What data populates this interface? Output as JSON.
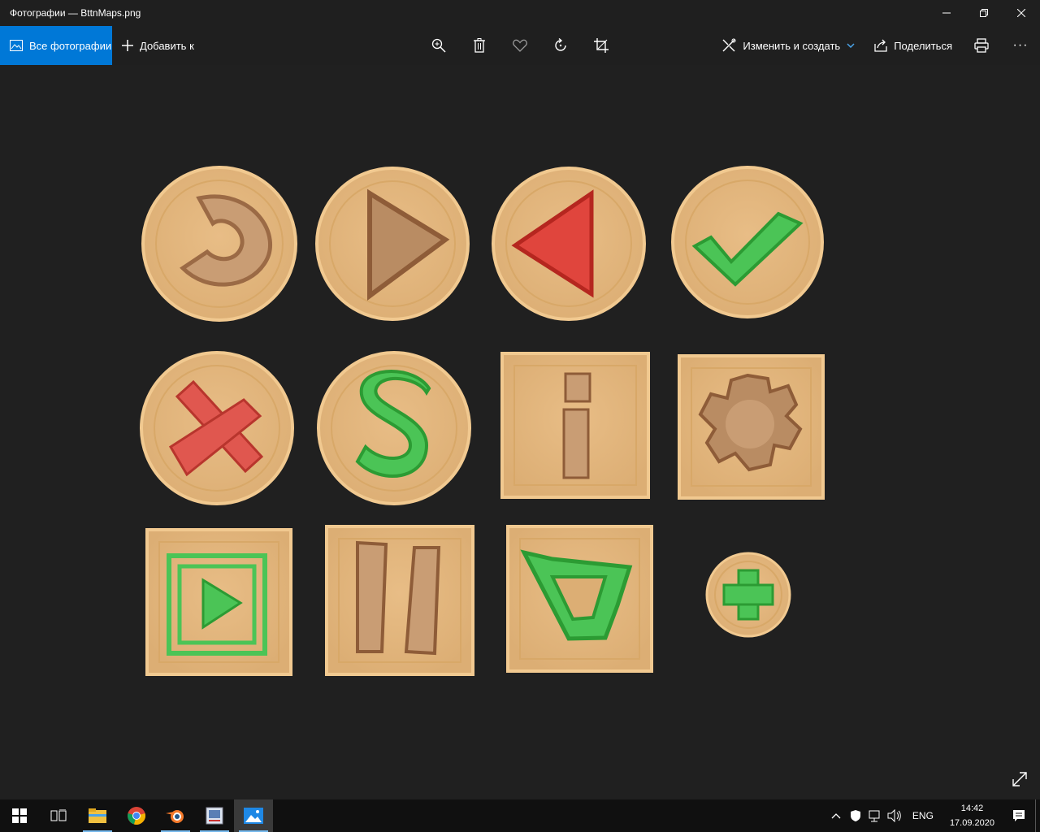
{
  "window": {
    "title": "Фотографии — BttnMaps.png"
  },
  "toolbar": {
    "all_photos_label": "Все фотографии",
    "add_to_label": "Добавить к",
    "edit_create_label": "Изменить и создать",
    "share_label": "Поделиться",
    "more_label": "···"
  },
  "image": {
    "filename": "BttnMaps.png",
    "buttons": [
      {
        "shape": "circle",
        "icon": "reload-arrow-icon",
        "color": "#9b6a45"
      },
      {
        "shape": "circle",
        "icon": "play-triangle-icon",
        "color": "#a97b53"
      },
      {
        "shape": "circle",
        "icon": "back-triangle-icon",
        "color": "#e0453d"
      },
      {
        "shape": "circle",
        "icon": "checkmark-icon",
        "color": "#3fc244"
      },
      {
        "shape": "circle",
        "icon": "cross-icon",
        "color": "#e0574f"
      },
      {
        "shape": "circle",
        "icon": "dollar-s-icon",
        "color": "#4bc456"
      },
      {
        "shape": "square",
        "icon": "info-i-icon",
        "color": "#9b6a45"
      },
      {
        "shape": "square",
        "icon": "gear-icon",
        "color": "#9b6a45"
      },
      {
        "shape": "square",
        "icon": "film-play-icon",
        "color": "#3fc244"
      },
      {
        "shape": "square",
        "icon": "pause-icon",
        "color": "#9b6a45"
      },
      {
        "shape": "square",
        "icon": "shop-cart-icon",
        "color": "#3fc244"
      },
      {
        "shape": "small-circle",
        "icon": "plus-icon",
        "color": "#3fc244"
      }
    ],
    "tile_color": "#e3b57c",
    "tile_rim": "#f0c88e"
  },
  "taskbar": {
    "apps": [
      "start-icon",
      "task-view-icon",
      "file-explorer-icon",
      "chrome-icon",
      "blender-icon",
      "paint-app-icon",
      "photos-app-icon"
    ],
    "language": "ENG",
    "time": "14:42",
    "date": "17.09.2020"
  }
}
